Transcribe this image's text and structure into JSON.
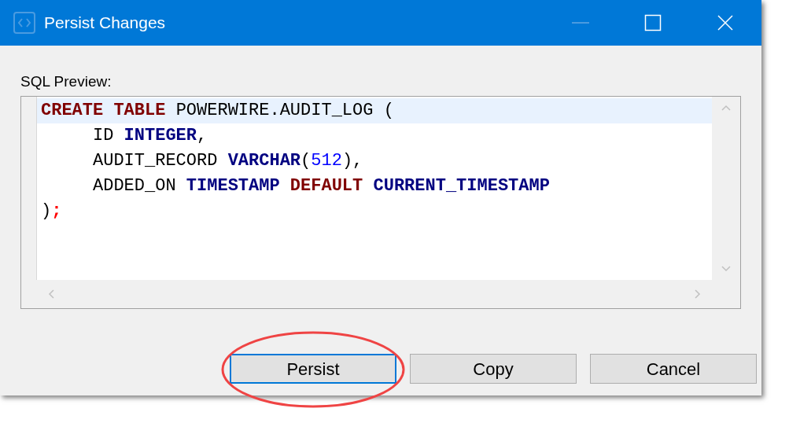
{
  "window": {
    "title": "Persist Changes",
    "controls": [
      {
        "kind": "minimize",
        "disabled": true
      },
      {
        "kind": "maximize",
        "disabled": false
      },
      {
        "kind": "close",
        "disabled": false
      }
    ]
  },
  "sql_preview": {
    "label": "SQL Preview:",
    "lines": [
      {
        "highlighted": true,
        "indent": false,
        "tokens": [
          {
            "text": "CREATE ",
            "kind": "keyword"
          },
          {
            "text": "TABLE",
            "kind": "keyword"
          },
          {
            "text": " POWERWIRE.AUDIT_LOG (",
            "kind": "plain"
          }
        ]
      },
      {
        "highlighted": false,
        "indent": true,
        "tokens": [
          {
            "text": "ID ",
            "kind": "plain"
          },
          {
            "text": "INTEGER",
            "kind": "type"
          },
          {
            "text": ",",
            "kind": "plain"
          }
        ]
      },
      {
        "highlighted": false,
        "indent": true,
        "tokens": [
          {
            "text": "AUDIT_RECORD ",
            "kind": "plain"
          },
          {
            "text": "VARCHAR",
            "kind": "type"
          },
          {
            "text": "(",
            "kind": "plain"
          },
          {
            "text": "512",
            "kind": "number"
          },
          {
            "text": "),",
            "kind": "plain"
          }
        ]
      },
      {
        "highlighted": false,
        "indent": true,
        "tokens": [
          {
            "text": "ADDED_ON ",
            "kind": "plain"
          },
          {
            "text": "TIMESTAMP ",
            "kind": "type"
          },
          {
            "text": "DEFAULT ",
            "kind": "keyword"
          },
          {
            "text": "CURRENT_TIMESTAMP",
            "kind": "type"
          }
        ]
      },
      {
        "highlighted": false,
        "indent": false,
        "tokens": [
          {
            "text": ")",
            "kind": "plain"
          },
          {
            "text": ";",
            "kind": "terminator"
          }
        ]
      }
    ]
  },
  "buttons": [
    {
      "label": "Persist",
      "focused": true,
      "circled": true
    },
    {
      "label": "Copy",
      "focused": false,
      "circled": false
    },
    {
      "label": "Cancel",
      "focused": false,
      "circled": false
    }
  ]
}
